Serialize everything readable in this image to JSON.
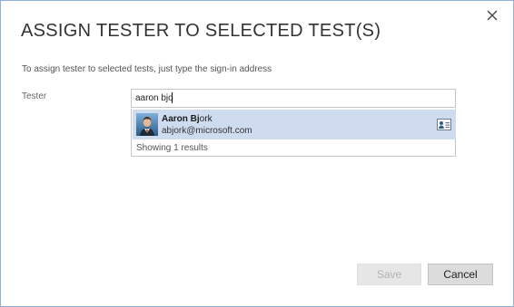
{
  "dialog": {
    "title": "ASSIGN TESTER TO SELECTED TEST(S)",
    "instruction": "To assign tester to selected tests, just type the sign-in address",
    "close_icon": "close-icon"
  },
  "tester": {
    "label": "Tester",
    "value": "aaron bjo"
  },
  "suggestions": {
    "items": [
      {
        "name_bold": "Aaron Bj",
        "name_rest": "ork",
        "email": "abjork@microsoft.com",
        "avatar_icon": "user-avatar",
        "card_icon": "contact-card-icon"
      }
    ],
    "results_text": "Showing 1 results"
  },
  "buttons": {
    "save": "Save",
    "cancel": "Cancel"
  },
  "colors": {
    "dialog_border": "#8fb0d6",
    "selected_row": "#cfdcf0",
    "disabled_button": "#e6e6e6",
    "cancel_button": "#dcdcdc"
  }
}
